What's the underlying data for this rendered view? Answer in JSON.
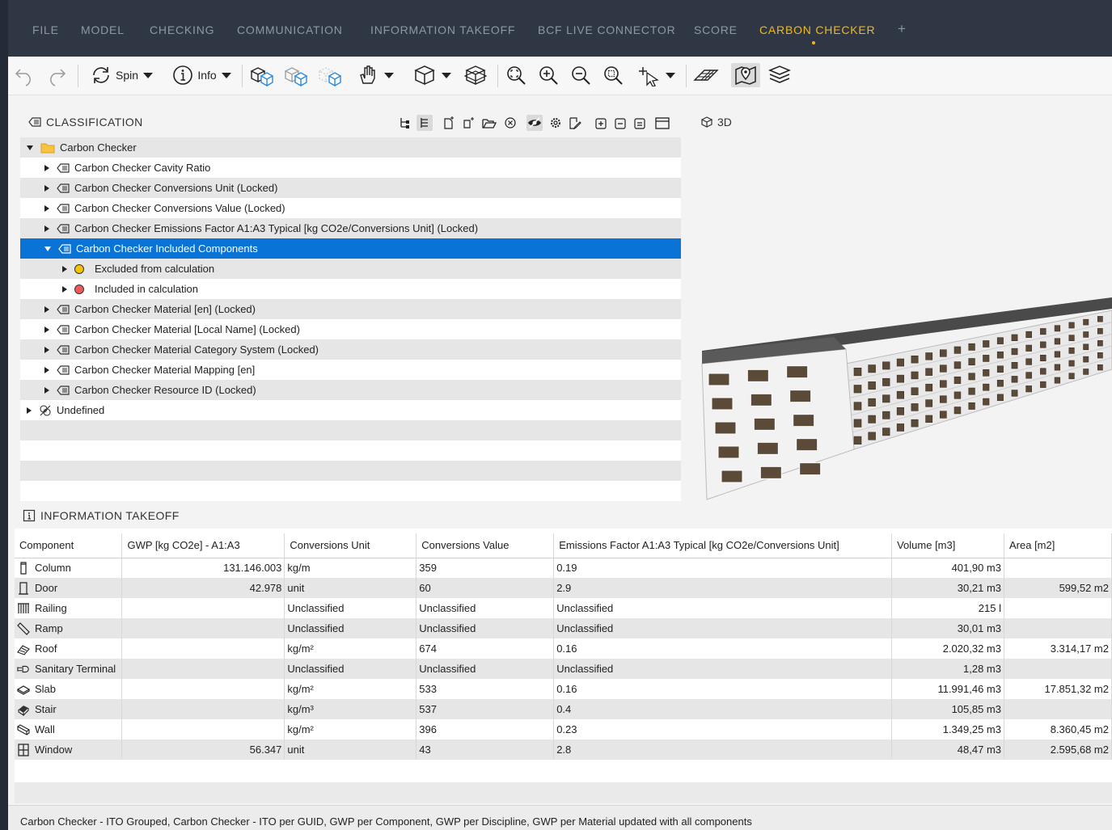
{
  "menu": {
    "items": [
      {
        "label": "FILE"
      },
      {
        "label": "MODEL"
      },
      {
        "label": "CHECKING"
      },
      {
        "label": "COMMUNICATION"
      },
      {
        "label": "INFORMATION TAKEOFF"
      },
      {
        "label": "BCF LIVE CONNECTOR"
      },
      {
        "label": "SCORE"
      },
      {
        "label": "CARBON CHECKER"
      }
    ],
    "active": "CARBON CHECKER",
    "add_label": "+"
  },
  "toolbar": {
    "spin_label": "Spin",
    "info_label": "Info"
  },
  "classification": {
    "title": "CLASSIFICATION",
    "tree": [
      {
        "label": "Carbon Checker",
        "level": 0,
        "expanded": true,
        "icon": "folder-icon"
      },
      {
        "label": "Carbon Checker Cavity Ratio",
        "level": 1,
        "icon": "tag-icon"
      },
      {
        "label": "Carbon Checker Conversions Unit (Locked)",
        "level": 1,
        "icon": "tag-icon"
      },
      {
        "label": "Carbon Checker Conversions Value (Locked)",
        "level": 1,
        "icon": "tag-icon"
      },
      {
        "label": "Carbon Checker Emissions Factor A1:A3 Typical [kg CO2e/Conversions Unit] (Locked)",
        "level": 1,
        "icon": "tag-icon"
      },
      {
        "label": "Carbon Checker Included Components",
        "level": 1,
        "expanded": true,
        "selected": true,
        "icon": "tag-icon"
      },
      {
        "label": "Excluded from calculation",
        "level": 2,
        "icon": "yellow-dot-icon"
      },
      {
        "label": "Included in calculation",
        "level": 2,
        "icon": "red-dot-icon"
      },
      {
        "label": "Carbon Checker Material [en] (Locked)",
        "level": 1,
        "icon": "tag-icon"
      },
      {
        "label": "Carbon Checker Material [Local Name] (Locked)",
        "level": 1,
        "icon": "tag-icon"
      },
      {
        "label": "Carbon Checker Material Category System (Locked)",
        "level": 1,
        "icon": "tag-icon"
      },
      {
        "label": "Carbon Checker Material Mapping [en]",
        "level": 1,
        "icon": "tag-icon"
      },
      {
        "label": "Carbon Checker Resource ID (Locked)",
        "level": 1,
        "icon": "tag-icon"
      },
      {
        "label": "Undefined",
        "level": 0,
        "icon": "undefined-icon"
      }
    ]
  },
  "viewport": {
    "label": "3D"
  },
  "ito": {
    "title": "INFORMATION TAKEOFF",
    "columns": [
      "Component",
      "GWP [kg CO2e] - A1:A3",
      "Conversions Unit",
      "Conversions Value",
      "Emissions Factor A1:A3 Typical [kg CO2e/Conversions Unit]",
      "Volume [m3]",
      "Area [m2]"
    ],
    "rows": [
      {
        "icon": "column-icon",
        "component": "Column",
        "gwp": "131.146.003",
        "unit": "kg/m",
        "value": "359",
        "factor": "0.19",
        "volume": "401,90 m3",
        "area": ""
      },
      {
        "icon": "door-icon",
        "component": "Door",
        "gwp": "42.978",
        "unit": "unit",
        "value": "60",
        "factor": "2.9",
        "volume": "30,21 m3",
        "area": "599,52 m2"
      },
      {
        "icon": "railing-icon",
        "component": "Railing",
        "gwp": "",
        "unit": "Unclassified",
        "value": "Unclassified",
        "factor": "Unclassified",
        "volume": "215 l",
        "area": ""
      },
      {
        "icon": "ramp-icon",
        "component": "Ramp",
        "gwp": "",
        "unit": "Unclassified",
        "value": "Unclassified",
        "factor": "Unclassified",
        "volume": "30,01 m3",
        "area": ""
      },
      {
        "icon": "roof-icon",
        "component": "Roof",
        "gwp": "",
        "unit": "kg/m²",
        "value": "674",
        "factor": "0.16",
        "volume": "2.020,32 m3",
        "area": "3.314,17 m2"
      },
      {
        "icon": "sanitary-terminal-icon",
        "component": "Sanitary Terminal",
        "gwp": "",
        "unit": "Unclassified",
        "value": "Unclassified",
        "factor": "Unclassified",
        "volume": "1,28 m3",
        "area": ""
      },
      {
        "icon": "slab-icon",
        "component": "Slab",
        "gwp": "",
        "unit": "kg/m²",
        "value": "533",
        "factor": "0.16",
        "volume": "11.991,46 m3",
        "area": "17.851,32 m2"
      },
      {
        "icon": "stair-icon",
        "component": "Stair",
        "gwp": "",
        "unit": "kg/m³",
        "value": "537",
        "factor": "0.4",
        "volume": "105,85 m3",
        "area": ""
      },
      {
        "icon": "wall-icon",
        "component": "Wall",
        "gwp": "",
        "unit": "kg/m²",
        "value": "396",
        "factor": "0.23",
        "volume": "1.349,25 m3",
        "area": "8.360,45 m2"
      },
      {
        "icon": "window-icon",
        "component": "Window",
        "gwp": "56.347",
        "unit": "unit",
        "value": "43",
        "factor": "2.8",
        "volume": "48,47 m3",
        "area": "2.595,68 m2"
      }
    ]
  },
  "status": {
    "text": "Carbon Checker - ITO Grouped, Carbon Checker - ITO per GUID, GWP per Component, GWP per Discipline, GWP per Material updated with all components"
  },
  "colors": {
    "menu_bg": "#2f3744",
    "menu_active": "#f2b81c",
    "selection": "#0a73d6",
    "excluded_dot": "#f5c400",
    "included_dot": "#f05a5a"
  }
}
